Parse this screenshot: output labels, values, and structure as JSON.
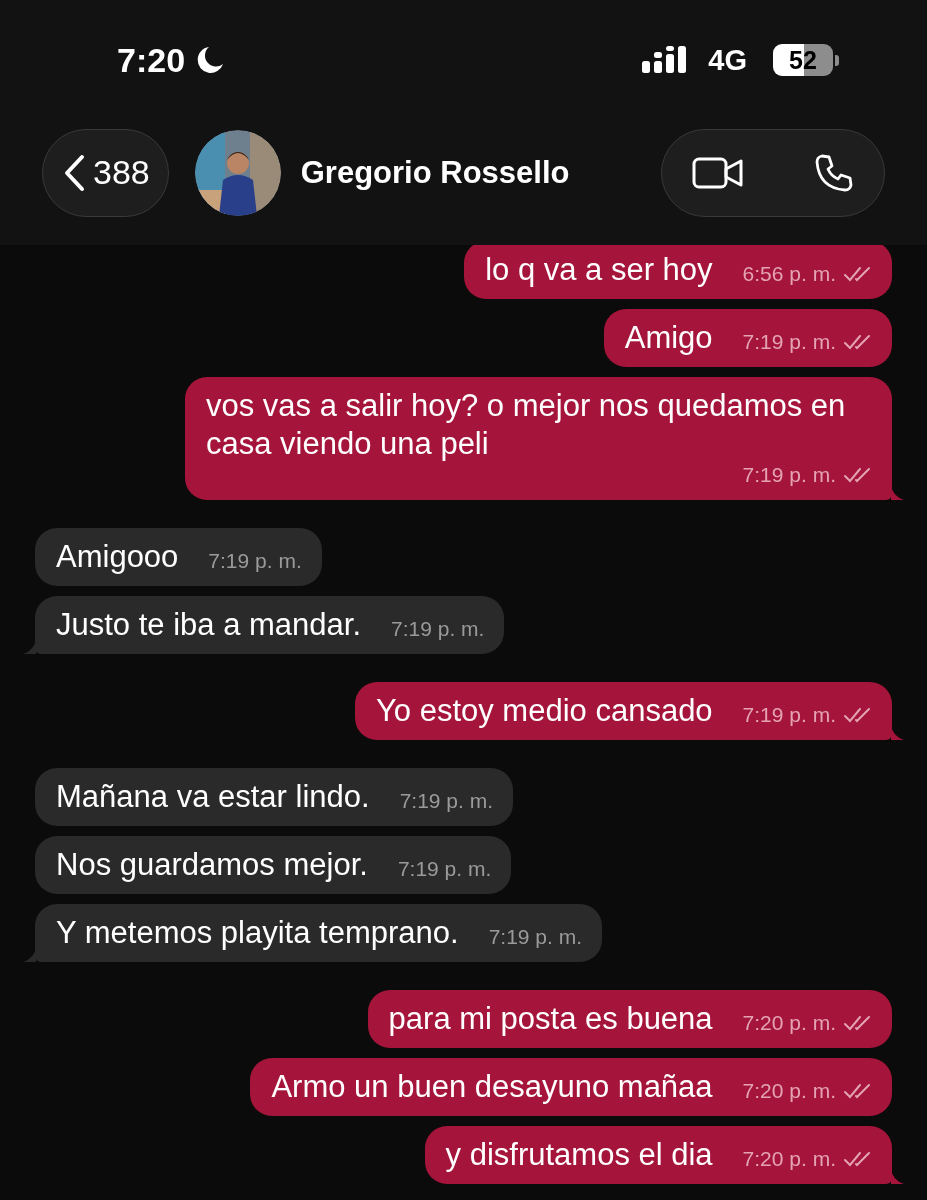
{
  "status_bar": {
    "time": "7:20",
    "network": "4G",
    "battery": "52"
  },
  "header": {
    "back_count": "388",
    "contact_name": "Gregorio Rossello"
  },
  "messages": [
    {
      "kind": "out",
      "text": "lo q va a ser hoy",
      "time": "6:56 p. m.",
      "tail": false
    },
    {
      "kind": "out",
      "text": "Amigo",
      "time": "7:19 p. m.",
      "tail": false
    },
    {
      "kind": "out",
      "text": "vos vas a salir hoy? o mejor nos quedamos en casa viendo una peli",
      "time": "7:19 p. m.",
      "tail": true
    },
    {
      "kind": "in",
      "text": "Amigooo",
      "time": "7:19 p. m.",
      "tail": false
    },
    {
      "kind": "in",
      "text": "Justo te iba a mandar.",
      "time": "7:19 p. m.",
      "tail": true
    },
    {
      "kind": "out",
      "text": "Yo estoy medio cansado",
      "time": "7:19 p. m.",
      "tail": true
    },
    {
      "kind": "in",
      "text": "Mañana va estar lindo.",
      "time": "7:19 p. m.",
      "tail": false
    },
    {
      "kind": "in",
      "text": "Nos guardamos mejor.",
      "time": "7:19 p. m.",
      "tail": false
    },
    {
      "kind": "in",
      "text": "Y metemos playita temprano.",
      "time": "7:19 p. m.",
      "tail": true
    },
    {
      "kind": "out",
      "text": "para mi posta es buena",
      "time": "7:20 p. m.",
      "tail": false
    },
    {
      "kind": "out",
      "text": "Armo un buen desayuno mañaa",
      "time": "7:20 p. m.",
      "tail": false
    },
    {
      "kind": "out",
      "text": "y disfrutamos el dia",
      "time": "7:20 p. m.",
      "tail": true
    }
  ]
}
